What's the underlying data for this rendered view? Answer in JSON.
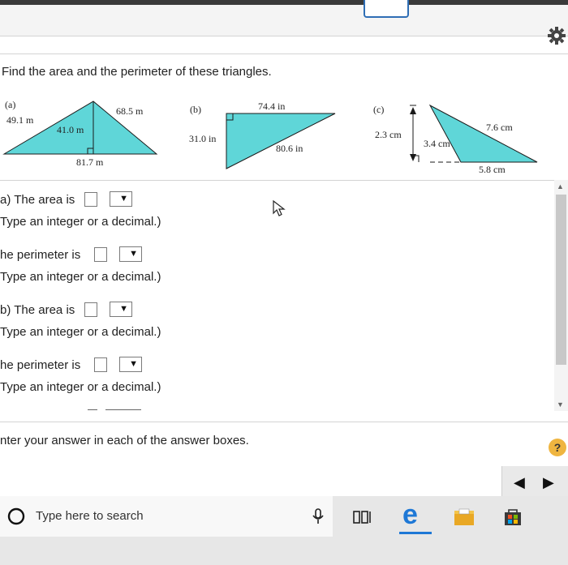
{
  "question": {
    "prompt": "Find the area and the perimeter of these triangles."
  },
  "figures": {
    "a": {
      "label": "(a)",
      "side_left": "49.1 m",
      "side_right": "68.5 m",
      "height": "41.0 m",
      "base": "81.7 m"
    },
    "b": {
      "label": "(b)",
      "top": "74.4 in",
      "left": "31.0 in",
      "hyp": "80.6 in"
    },
    "c": {
      "label": "(c)",
      "height": "2.3 cm",
      "side": "7.6 cm",
      "left_side": "3.4 cm",
      "base": "5.8 cm"
    }
  },
  "answers": [
    {
      "label": "a) The area is",
      "hint": "Type an integer or a decimal.)"
    },
    {
      "label": "he perimeter is",
      "hint": "Type an integer or a decimal.)"
    },
    {
      "label": "b) The area is",
      "hint": "Type an integer or a decimal.)"
    },
    {
      "label": "he perimeter is",
      "hint": "Type an integer or a decimal.)"
    }
  ],
  "footer": {
    "enter_hint": "nter your answer in each of the answer boxes.",
    "help_label": "?"
  },
  "taskbar": {
    "search_placeholder": "Type here to search"
  },
  "colors": {
    "triangle_fill": "#5fd6d8",
    "link_blue": "#2f6eb5",
    "help_orange": "#efb540"
  },
  "icons": [
    "settings-gear-icon",
    "mouse-cursor-icon",
    "scroll-up-icon",
    "scroll-down-icon",
    "help-icon",
    "prev-arrow-icon",
    "next-arrow-icon",
    "cortana-circle-icon",
    "microphone-icon",
    "task-view-icon",
    "edge-browser-icon",
    "file-explorer-icon",
    "store-icon"
  ]
}
